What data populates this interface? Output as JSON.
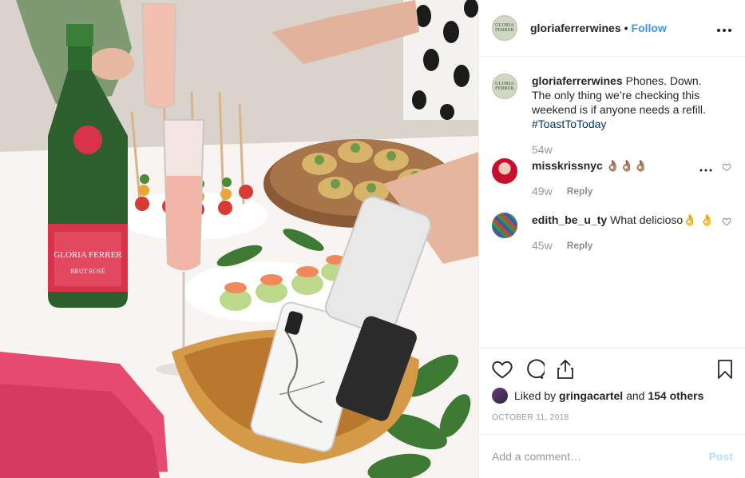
{
  "post": {
    "author": "gloriaferrerwines",
    "follow_label": "Follow",
    "separator": "•",
    "brand_avatar_text": "GLORIA FERRER",
    "caption": {
      "username": "gloriaferrerwines",
      "text": "Phones. Down. The only thing we’re checking this weekend is if anyone needs a refill.",
      "hashtag": "#ToastToToday",
      "age": "54w"
    },
    "comments": [
      {
        "username": "misskrissnyc",
        "text": "👌🏽👌🏽👌🏽",
        "age": "49w",
        "reply_label": "Reply"
      },
      {
        "username": "edith_be_u_ty",
        "text": "What delicioso👌 👌",
        "age": "45w",
        "reply_label": "Reply"
      }
    ],
    "likes": {
      "prefix": "Liked by",
      "user": "gringacartel",
      "conjunction": "and",
      "others": "154 others"
    },
    "date": "OCTOBER 11, 2018",
    "add_comment": {
      "placeholder": "Add a comment…",
      "post_label": "Post"
    }
  },
  "photo": {
    "bottle_label_brand": "GLORIA FERRER",
    "bottle_label_sub": "BRUT ROSÉ"
  },
  "icons": [
    "more-icon",
    "heart-icon",
    "comment-icon",
    "share-icon",
    "bookmark-icon"
  ],
  "colors": {
    "link": "#3897f0",
    "post_disabled": "#b2dffc",
    "hashtag": "#003569",
    "muted": "#999999"
  }
}
